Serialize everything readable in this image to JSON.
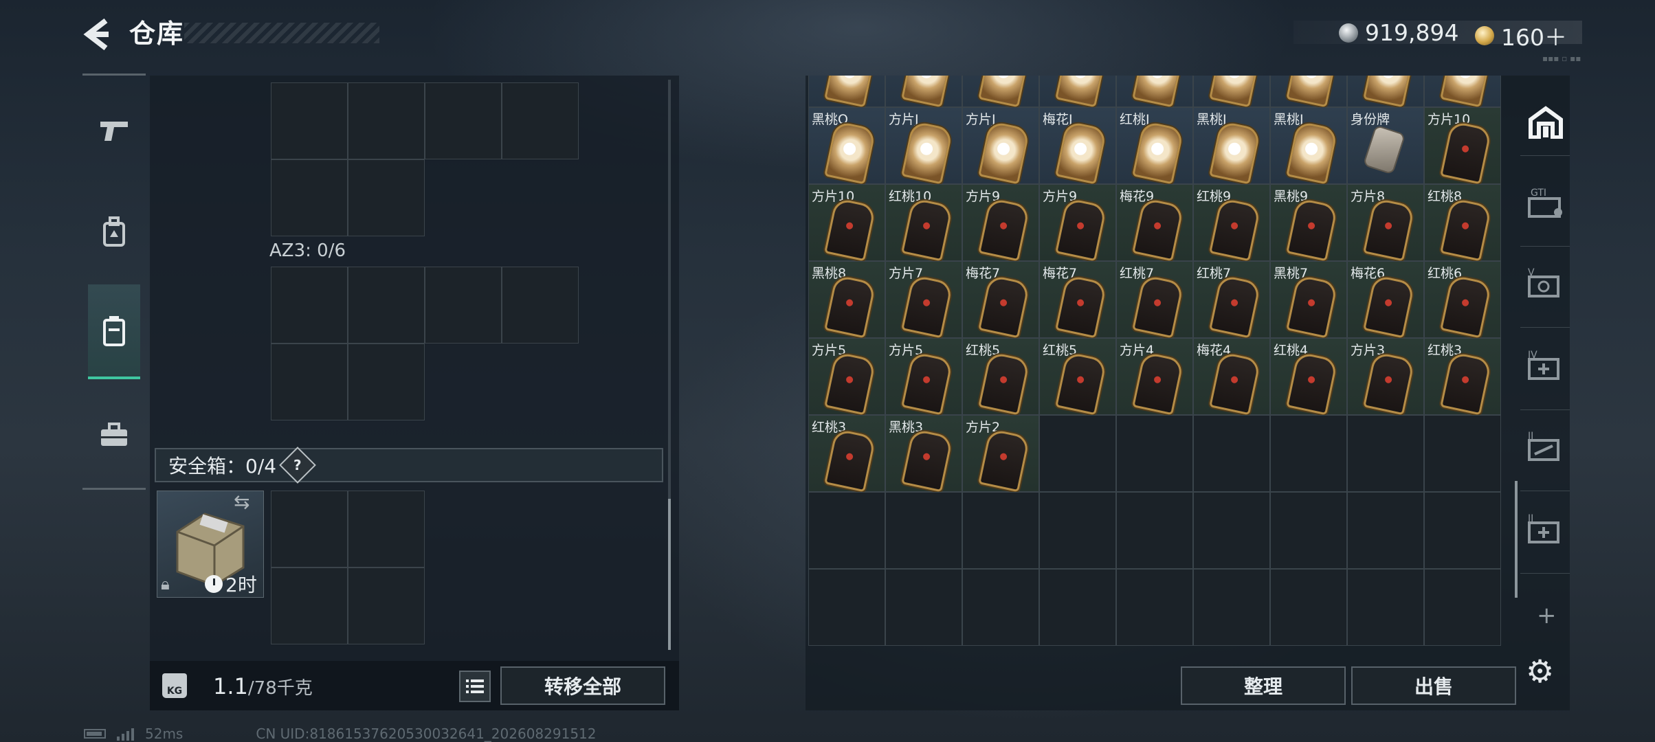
{
  "header": {
    "title": "仓库",
    "silver": "919,894",
    "gold": "160＋"
  },
  "left": {
    "az3_label": "AZ3: 0/6",
    "safe_label": "安全箱：0/4",
    "help": "?",
    "safe_timer": "2时",
    "weight_current": "1.1",
    "weight_max": "/78千克",
    "weight_icon_text": "KG",
    "transfer_all": "转移全部"
  },
  "right": {
    "sort_label": "整理",
    "sell_label": "出售",
    "plus": "+",
    "tabs": [
      "home-tab",
      "g-tab",
      "v-tab",
      "iv-tab",
      "iii-tab",
      "ii-tab"
    ],
    "items": [
      {
        "label": "",
        "type": "face"
      },
      {
        "label": "",
        "type": "face"
      },
      {
        "label": "",
        "type": "face"
      },
      {
        "label": "",
        "type": "face"
      },
      {
        "label": "",
        "type": "face"
      },
      {
        "label": "",
        "type": "face"
      },
      {
        "label": "",
        "type": "face"
      },
      {
        "label": "",
        "type": "face"
      },
      {
        "label": "",
        "type": "face"
      },
      {
        "label": "黑桃Q",
        "type": "face"
      },
      {
        "label": "方片J",
        "type": "face"
      },
      {
        "label": "方片J",
        "type": "face"
      },
      {
        "label": "梅花J",
        "type": "face"
      },
      {
        "label": "红桃J",
        "type": "face"
      },
      {
        "label": "黑桃J",
        "type": "face"
      },
      {
        "label": "黑桃J",
        "type": "face"
      },
      {
        "label": "身份牌",
        "type": "tag"
      },
      {
        "label": "方片10",
        "type": "card"
      },
      {
        "label": "方片10",
        "type": "card"
      },
      {
        "label": "红桃10",
        "type": "card"
      },
      {
        "label": "方片9",
        "type": "card"
      },
      {
        "label": "方片9",
        "type": "card"
      },
      {
        "label": "梅花9",
        "type": "card"
      },
      {
        "label": "红桃9",
        "type": "card"
      },
      {
        "label": "黑桃9",
        "type": "card"
      },
      {
        "label": "方片8",
        "type": "card"
      },
      {
        "label": "红桃8",
        "type": "card"
      },
      {
        "label": "黑桃8",
        "type": "card"
      },
      {
        "label": "方片7",
        "type": "card"
      },
      {
        "label": "梅花7",
        "type": "card"
      },
      {
        "label": "梅花7",
        "type": "card"
      },
      {
        "label": "红桃7",
        "type": "card"
      },
      {
        "label": "红桃7",
        "type": "card"
      },
      {
        "label": "黑桃7",
        "type": "card"
      },
      {
        "label": "梅花6",
        "type": "card"
      },
      {
        "label": "红桃6",
        "type": "card"
      },
      {
        "label": "方片5",
        "type": "card"
      },
      {
        "label": "方片5",
        "type": "card"
      },
      {
        "label": "红桃5",
        "type": "card"
      },
      {
        "label": "红桃5",
        "type": "card"
      },
      {
        "label": "方片4",
        "type": "card"
      },
      {
        "label": "梅花4",
        "type": "card"
      },
      {
        "label": "红桃4",
        "type": "card"
      },
      {
        "label": "方片3",
        "type": "card"
      },
      {
        "label": "红桃3",
        "type": "card"
      },
      {
        "label": "红桃3",
        "type": "card"
      },
      {
        "label": "黑桃3",
        "type": "card"
      },
      {
        "label": "方片2",
        "type": "card"
      }
    ]
  },
  "footer": {
    "ping": "52ms",
    "uid": "CN UID:81861537620530032641_202608291512"
  }
}
